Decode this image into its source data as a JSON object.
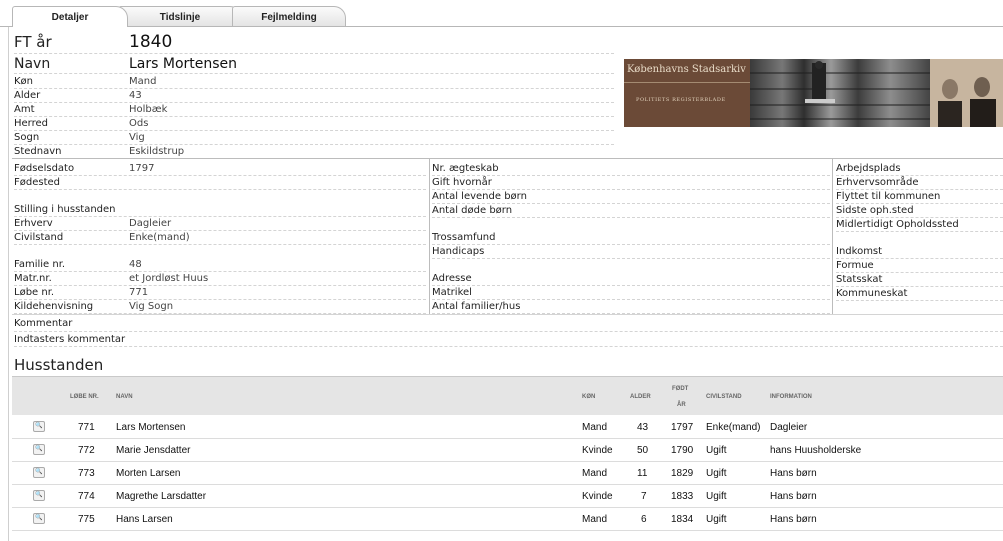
{
  "tabs": [
    "Detaljer",
    "Tidslinje",
    "Fejlmelding"
  ],
  "ft_aar": {
    "label": "FT år",
    "value": "1840"
  },
  "navn": {
    "label": "Navn",
    "value": "Lars Mortensen"
  },
  "person": [
    {
      "label": "Køn",
      "value": "Mand"
    },
    {
      "label": "Alder",
      "value": "43"
    },
    {
      "label": "Amt",
      "value": "Holbæk"
    },
    {
      "label": "Herred",
      "value": "Ods"
    },
    {
      "label": "Sogn",
      "value": "Vig"
    },
    {
      "label": "Stednavn",
      "value": "Eskildstrup"
    }
  ],
  "archive": {
    "title": "Københavns Stadsarkiv",
    "subtitle": "POLITIETS REGISTERBLADE"
  },
  "col1": [
    {
      "label": "Fødselsdato",
      "value": "1797"
    },
    {
      "label": "Fødested",
      "value": ""
    },
    {
      "label": "Stilling i husstanden",
      "value": ""
    },
    {
      "label": "Erhverv",
      "value": "Dagleier"
    },
    {
      "label": "Civilstand",
      "value": "Enke(mand)"
    },
    {
      "label": "Familie nr.",
      "value": "48"
    },
    {
      "label": "Matr.nr.",
      "value": "et Jordløst Huus"
    },
    {
      "label": "Løbe nr.",
      "value": "771"
    },
    {
      "label": "Kildehenvisning",
      "value": "Vig Sogn"
    }
  ],
  "col2": [
    "Nr. ægteskab",
    "Gift hvornår",
    "Antal levende børn",
    "Antal døde børn",
    "Trossamfund",
    "Handicaps",
    "Adresse",
    "Matrikel",
    "Antal familier/hus"
  ],
  "col3": [
    "Arbejdsplads",
    "Erhvervsområde",
    "Flyttet til kommunen",
    "Sidste oph.sted",
    "Midlertidigt Opholdssted",
    "Indkomst",
    "Formue",
    "Statsskat",
    "Kommuneskat"
  ],
  "kommentar": "Kommentar",
  "indtaster": "Indtasters kommentar",
  "husstanden": {
    "title": "Husstanden",
    "headers": {
      "lobenr": "LØBE NR.",
      "navn": "NAVN",
      "kon": "KØN",
      "alder": "ALDER",
      "fodt1": "FØDT",
      "fodt2": "ÅR",
      "civil": "CIVILSTAND",
      "info": "INFORMATION"
    },
    "rows": [
      {
        "nr": "771",
        "navn": "Lars Mortensen",
        "kon": "Mand",
        "alder": "43",
        "fodt": "1797",
        "civil": "Enke(mand)",
        "info": "Dagleier"
      },
      {
        "nr": "772",
        "navn": "Marie Jensdatter",
        "kon": "Kvinde",
        "alder": "50",
        "fodt": "1790",
        "civil": "Ugift",
        "info": "hans Huusholderske"
      },
      {
        "nr": "773",
        "navn": "Morten Larsen",
        "kon": "Mand",
        "alder": "11",
        "fodt": "1829",
        "civil": "Ugift",
        "info": "Hans børn"
      },
      {
        "nr": "774",
        "navn": "Magrethe Larsdatter",
        "kon": "Kvinde",
        "alder": "7",
        "fodt": "1833",
        "civil": "Ugift",
        "info": "Hans børn"
      },
      {
        "nr": "775",
        "navn": "Hans Larsen",
        "kon": "Mand",
        "alder": "6",
        "fodt": "1834",
        "civil": "Ugift",
        "info": "Hans børn"
      }
    ]
  }
}
